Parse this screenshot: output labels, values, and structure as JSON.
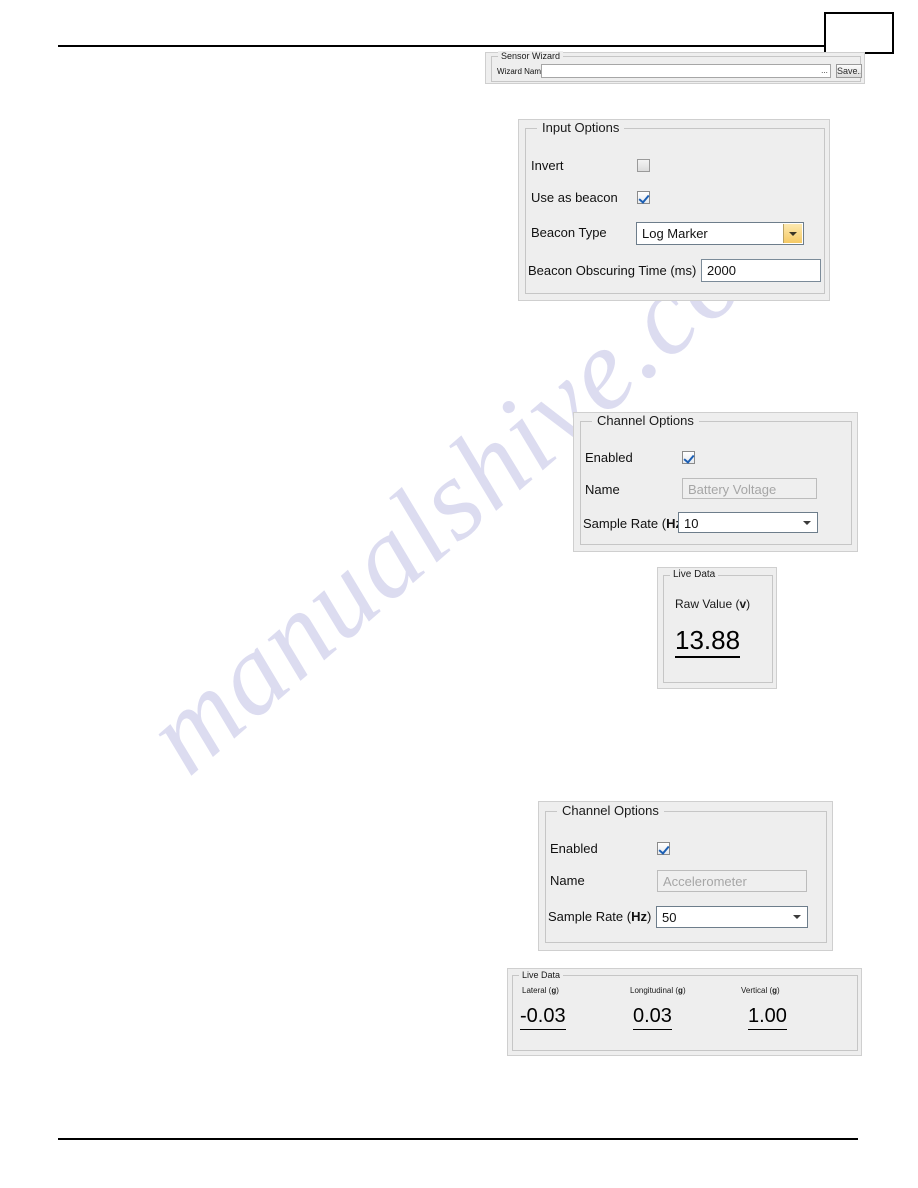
{
  "page": {
    "page_number_box": "",
    "watermark_text": "manualshive.com"
  },
  "sensor_wizard": {
    "group_title": "Sensor Wizard",
    "wizard_name_label": "Wizard Name",
    "wizard_name_value": "",
    "wizard_name_placeholder": "",
    "browse_button_label": "...",
    "save_button_label": "Save..."
  },
  "input_options": {
    "group_title": "Input Options",
    "invert_label": "Invert",
    "invert_checked": false,
    "use_as_beacon_label": "Use as beacon",
    "use_as_beacon_checked": true,
    "beacon_type_label": "Beacon Type",
    "beacon_type_value": "Log Marker",
    "beacon_type_options": [
      "Log Marker"
    ],
    "beacon_obscuring_time_label": "Beacon Obscuring Time (ms)",
    "beacon_obscuring_time_value": "2000"
  },
  "channel_options_battery": {
    "group_title": "Channel Options",
    "enabled_label": "Enabled",
    "enabled_checked": true,
    "name_label": "Name",
    "name_value": "Battery Voltage",
    "name_disabled": true,
    "sample_rate_label_prefix": "Sample Rate (",
    "sample_rate_label_unit": "Hz",
    "sample_rate_label_suffix": ")",
    "sample_rate_value": "10",
    "sample_rate_options": [
      "10"
    ]
  },
  "live_data_battery": {
    "group_title": "Live Data",
    "raw_value_label_prefix": "Raw Value (",
    "raw_value_label_unit": "v",
    "raw_value_label_suffix": ")",
    "raw_value": "13.88"
  },
  "channel_options_accelerometer": {
    "group_title": "Channel Options",
    "enabled_label": "Enabled",
    "enabled_checked": true,
    "name_label": "Name",
    "name_value": "Accelerometer",
    "name_disabled": true,
    "sample_rate_label_prefix": "Sample Rate (",
    "sample_rate_label_unit": "Hz",
    "sample_rate_label_suffix": ")",
    "sample_rate_value": "50",
    "sample_rate_options": [
      "50"
    ]
  },
  "live_data_accelerometer": {
    "group_title": "Live Data",
    "channels": [
      {
        "label_prefix": "Lateral (",
        "label_unit": "g",
        "label_suffix": ")",
        "value": "-0.03"
      },
      {
        "label_prefix": "Longitudinal (",
        "label_unit": "g",
        "label_suffix": ")",
        "value": "0.03"
      },
      {
        "label_prefix": "Vertical (",
        "label_unit": "g",
        "label_suffix": ")",
        "value": "1.00"
      }
    ]
  },
  "colors": {
    "panel_background": "#eeeeee",
    "combo_button_accent": "#f5c964",
    "checkbox_check": "#1c5fb4",
    "disabled_text": "#a6a6a6",
    "watermark": "#c8c8e8"
  }
}
